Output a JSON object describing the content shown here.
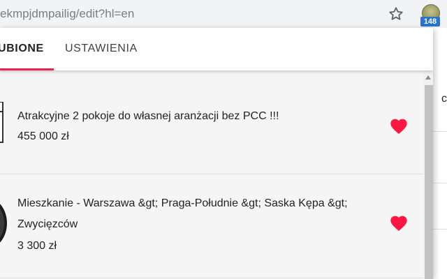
{
  "browser": {
    "url_text": "ekmpjdmpailig/edit?hl=en",
    "extension_badge": "148"
  },
  "tabs": [
    {
      "label": "ULUBIONE",
      "visible_label": "UBIONE",
      "active": true
    },
    {
      "label": "USTAWIENIA",
      "active": false
    }
  ],
  "colors": {
    "accent": "#e8214d",
    "heart": "#ff1744",
    "badge": "#2a74c9"
  },
  "favorites": [
    {
      "title": "Atrakcyjne 2 pokoje do własnej aranżacji bez PCC !!!",
      "price": "455 000 zł",
      "icon": "heart-icon"
    },
    {
      "title": "Mieszkanie - Warszawa &gt; Praga-Południe &gt; Saska Kępa &gt; Zwycięzców",
      "price": "3 300 zł",
      "icon": "heart-icon"
    }
  ],
  "page_behind": {
    "edge_char": "c"
  }
}
